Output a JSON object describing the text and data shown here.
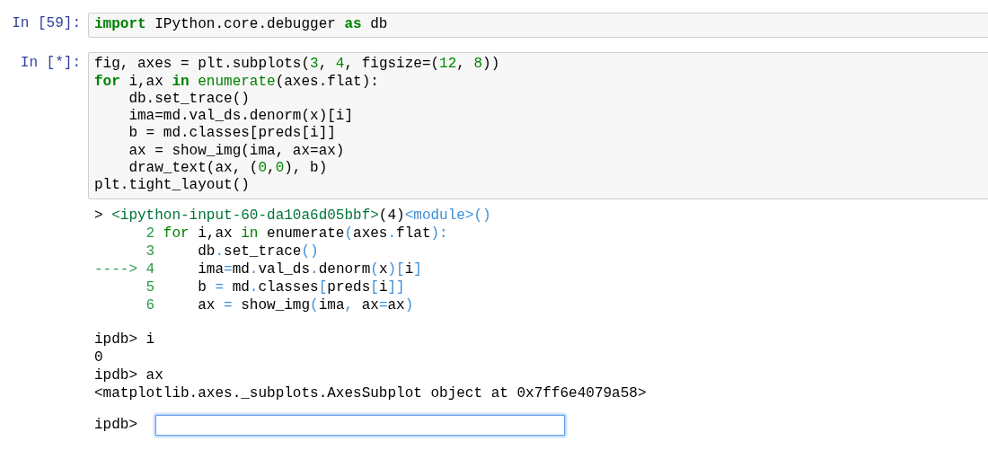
{
  "cells": [
    {
      "prompt": "In [59]:",
      "lines": [
        [
          {
            "kind": "keyword",
            "text": "import"
          },
          {
            "kind": "plain",
            "text": " IPython.core.debugger "
          },
          {
            "kind": "keyword",
            "text": "as"
          },
          {
            "kind": "plain",
            "text": " db"
          }
        ]
      ]
    },
    {
      "prompt": "In [*]:",
      "lines": [
        [
          {
            "kind": "plain",
            "text": "fig, axes = plt.subplots("
          },
          {
            "kind": "number",
            "text": "3"
          },
          {
            "kind": "plain",
            "text": ", "
          },
          {
            "kind": "number",
            "text": "4"
          },
          {
            "kind": "plain",
            "text": ", figsize=("
          },
          {
            "kind": "number",
            "text": "12"
          },
          {
            "kind": "plain",
            "text": ", "
          },
          {
            "kind": "number",
            "text": "8"
          },
          {
            "kind": "plain",
            "text": "))"
          }
        ],
        [
          {
            "kind": "keyword",
            "text": "for"
          },
          {
            "kind": "plain",
            "text": " i,ax "
          },
          {
            "kind": "keyword",
            "text": "in"
          },
          {
            "kind": "builtin",
            "text": " enumerate"
          },
          {
            "kind": "plain",
            "text": "(axes.flat):"
          }
        ],
        [
          {
            "kind": "plain",
            "text": "    db.set_trace()"
          }
        ],
        [
          {
            "kind": "plain",
            "text": "    ima=md.val_ds.denorm(x)[i]"
          }
        ],
        [
          {
            "kind": "plain",
            "text": "    b = md.classes[preds[i]]"
          }
        ],
        [
          {
            "kind": "plain",
            "text": "    ax = show_img(ima, ax=ax)"
          }
        ],
        [
          {
            "kind": "plain",
            "text": "    draw_text(ax, ("
          },
          {
            "kind": "number",
            "text": "0"
          },
          {
            "kind": "plain",
            "text": ","
          },
          {
            "kind": "number",
            "text": "0"
          },
          {
            "kind": "plain",
            "text": "), b)"
          }
        ],
        [
          {
            "kind": "plain",
            "text": "plt.tight_layout()"
          }
        ]
      ],
      "output": {
        "traceback": [
          [
            {
              "kind": "plain",
              "text": "> "
            },
            {
              "kind": "file",
              "text": "<ipython-input-60-da10a6d05bbf>"
            },
            {
              "kind": "plain",
              "text": "(4)"
            },
            {
              "kind": "module",
              "text": "<module>()"
            }
          ],
          [
            {
              "kind": "lineno",
              "text": "      2 "
            },
            {
              "kind": "builtin",
              "text": "for"
            },
            {
              "kind": "plain",
              "text": " i,ax "
            },
            {
              "kind": "builtin",
              "text": "in"
            },
            {
              "kind": "plain",
              "text": " enumerate"
            },
            {
              "kind": "punct",
              "text": "("
            },
            {
              "kind": "plain",
              "text": "axes"
            },
            {
              "kind": "punct",
              "text": "."
            },
            {
              "kind": "plain",
              "text": "flat"
            },
            {
              "kind": "punct",
              "text": "):"
            }
          ],
          [
            {
              "kind": "lineno",
              "text": "      3 "
            },
            {
              "kind": "plain",
              "text": "    db"
            },
            {
              "kind": "punct",
              "text": "."
            },
            {
              "kind": "plain",
              "text": "set_trace"
            },
            {
              "kind": "punct",
              "text": "()"
            }
          ],
          [
            {
              "kind": "lineno",
              "text": "----> 4 "
            },
            {
              "kind": "plain",
              "text": "    ima"
            },
            {
              "kind": "punct",
              "text": "="
            },
            {
              "kind": "plain",
              "text": "md"
            },
            {
              "kind": "punct",
              "text": "."
            },
            {
              "kind": "plain",
              "text": "val_ds"
            },
            {
              "kind": "punct",
              "text": "."
            },
            {
              "kind": "plain",
              "text": "denorm"
            },
            {
              "kind": "punct",
              "text": "("
            },
            {
              "kind": "plain",
              "text": "x"
            },
            {
              "kind": "punct",
              "text": ")["
            },
            {
              "kind": "plain",
              "text": "i"
            },
            {
              "kind": "punct",
              "text": "]"
            }
          ],
          [
            {
              "kind": "lineno",
              "text": "      5 "
            },
            {
              "kind": "plain",
              "text": "    b "
            },
            {
              "kind": "punct",
              "text": "="
            },
            {
              "kind": "plain",
              "text": " md"
            },
            {
              "kind": "punct",
              "text": "."
            },
            {
              "kind": "plain",
              "text": "classes"
            },
            {
              "kind": "punct",
              "text": "["
            },
            {
              "kind": "plain",
              "text": "preds"
            },
            {
              "kind": "punct",
              "text": "["
            },
            {
              "kind": "plain",
              "text": "i"
            },
            {
              "kind": "punct",
              "text": "]]"
            }
          ],
          [
            {
              "kind": "lineno",
              "text": "      6 "
            },
            {
              "kind": "plain",
              "text": "    ax "
            },
            {
              "kind": "punct",
              "text": "="
            },
            {
              "kind": "plain",
              "text": " show_img"
            },
            {
              "kind": "punct",
              "text": "("
            },
            {
              "kind": "plain",
              "text": "ima"
            },
            {
              "kind": "punct",
              "text": ","
            },
            {
              "kind": "plain",
              "text": " ax"
            },
            {
              "kind": "punct",
              "text": "="
            },
            {
              "kind": "plain",
              "text": "ax"
            },
            {
              "kind": "punct",
              "text": ")"
            }
          ]
        ],
        "console": [
          "ipdb> i",
          "0",
          "ipdb> ax",
          "<matplotlib.axes._subplots.AxesSubplot object at 0x7ff6e4079a58>"
        ],
        "input": {
          "label": "ipdb>",
          "focused": true
        }
      }
    }
  ]
}
